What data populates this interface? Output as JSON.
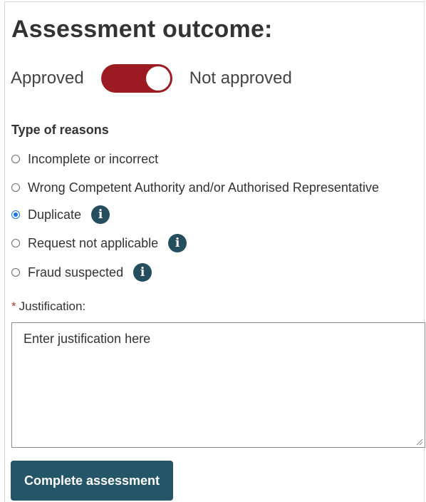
{
  "title": "Assessment outcome:",
  "outcome_toggle": {
    "left_label": "Approved",
    "right_label": "Not approved",
    "state": "Not approved",
    "color": "#9c1b22"
  },
  "reasons": {
    "heading": "Type of reasons",
    "options": [
      {
        "label": "Incomplete or incorrect",
        "selected": false,
        "info": false
      },
      {
        "label": "Wrong Competent Authority and/or Authorised Representative",
        "selected": false,
        "info": false
      },
      {
        "label": "Duplicate",
        "selected": true,
        "info": true
      },
      {
        "label": "Request not applicable",
        "selected": false,
        "info": true
      },
      {
        "label": "Fraud suspected",
        "selected": false,
        "info": true
      }
    ],
    "info_icon": "i"
  },
  "justification": {
    "required_marker": "*",
    "label": "Justification:",
    "placeholder": "Enter justification here",
    "value": ""
  },
  "submit": {
    "label": "Complete assessment",
    "color": "#255668"
  }
}
